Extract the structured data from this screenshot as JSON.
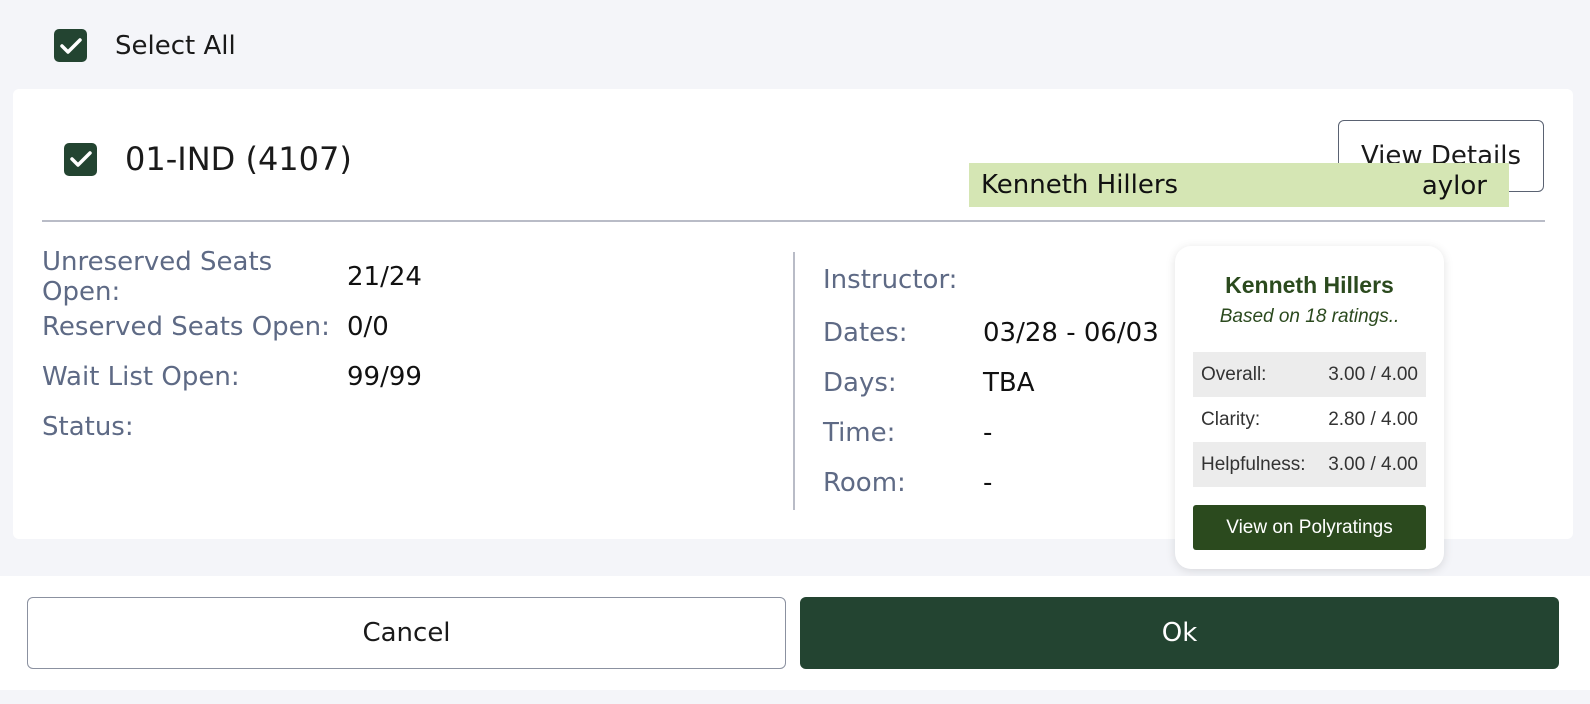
{
  "select_all": {
    "label": "Select All",
    "checked": true
  },
  "section": {
    "title": "01-IND (4107)",
    "checked": true,
    "view_details_label": "View Details"
  },
  "seats": [
    {
      "label": "Unreserved Seats Open:",
      "value": "21/24"
    },
    {
      "label": "Reserved Seats Open:",
      "value": "0/0"
    },
    {
      "label": "Wait List Open:",
      "value": "99/99"
    },
    {
      "label": "Status:",
      "value": ""
    }
  ],
  "schedule": [
    {
      "label": "Instructor:",
      "value": "Kenneth Hillers"
    },
    {
      "label": "Dates:",
      "value": "03/28 - 06/03"
    },
    {
      "label": "Days:",
      "value": "TBA"
    },
    {
      "label": "Time:",
      "value": "-"
    },
    {
      "label": "Room:",
      "value": "-"
    }
  ],
  "instructor_chip": {
    "name": "Kenneth Hillers",
    "tail": "aylor"
  },
  "popup": {
    "name": "Kenneth Hillers",
    "subtitle": "Based on 18 ratings..",
    "ratings": [
      {
        "label": "Overall:",
        "value": "3.00 / 4.00"
      },
      {
        "label": "Clarity:",
        "value": "2.80 / 4.00"
      },
      {
        "label": "Helpfulness:",
        "value": "3.00 / 4.00"
      }
    ],
    "button_label": "View on Polyratings"
  },
  "footer": {
    "cancel_label": "Cancel",
    "ok_label": "Ok"
  },
  "colors": {
    "accent": "#234431",
    "popup_green": "#2b4a1e",
    "chip_bg": "#d5e6b4"
  },
  "icons": {
    "checkbox": "checkmark-icon"
  }
}
